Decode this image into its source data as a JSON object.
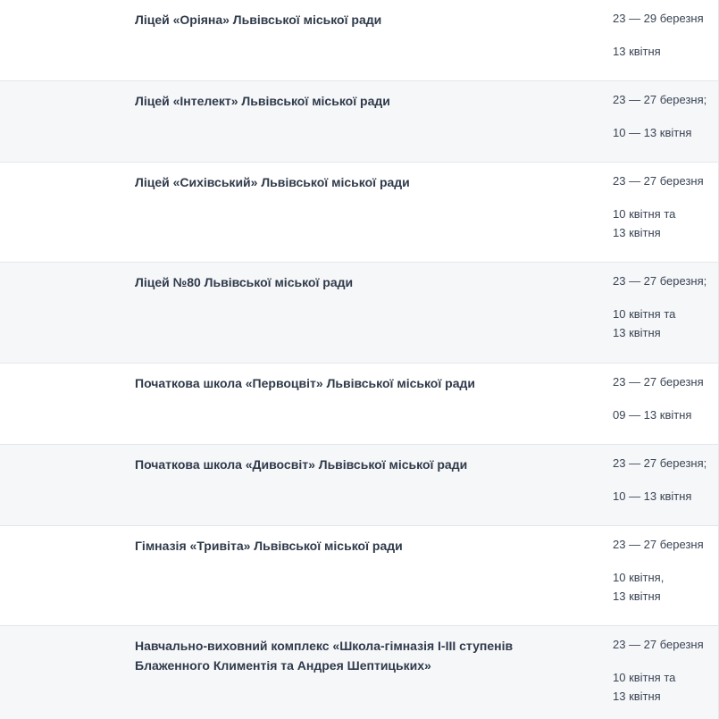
{
  "rows": [
    {
      "school": "Ліцей «Оріяна» Львівської міської ради",
      "period1": "23 — 29 березня",
      "period2": [
        "13 квітня"
      ]
    },
    {
      "school": "Ліцей «Інтелект» Львівської міської ради",
      "period1": "23 — 27 березня;",
      "period2": [
        "10 — 13 квітня"
      ]
    },
    {
      "school": "Ліцей «Сихівський» Львівської міської ради",
      "period1": "23 — 27 березня",
      "period2": [
        "10 квітня та",
        "13 квітня"
      ]
    },
    {
      "school": "Ліцей №80 Львівської міської ради",
      "period1": "23 — 27 березня;",
      "period2": [
        "10 квітня та",
        "13 квітня"
      ]
    },
    {
      "school": "Початкова школа «Первоцвіт» Львівської міської ради",
      "period1": "23 — 27 березня",
      "period2": [
        "09 — 13 квітня"
      ]
    },
    {
      "school": "Початкова школа «Дивосвіт» Львівської міської ради",
      "period1": "23 — 27 березня;",
      "period2": [
        "10 — 13 квітня"
      ]
    },
    {
      "school": "Гімназія «Тривіта» Львівської міської ради",
      "period1": "23 — 27 березня",
      "period2": [
        "10 квітня,",
        "13 квітня"
      ]
    },
    {
      "school": "Навчально-виховний комплекс «Школа-гімназія І-ІІІ ступенів Блаженного Климентія та Андрея Шептицьких»",
      "period1": "23 — 27 березня",
      "period2": [
        "10 квітня та",
        "13 квітня"
      ]
    }
  ],
  "colors": {
    "row_alt_background": "#f6f7f9",
    "border": "#e3e6ea",
    "text": "#2f3a4a"
  }
}
